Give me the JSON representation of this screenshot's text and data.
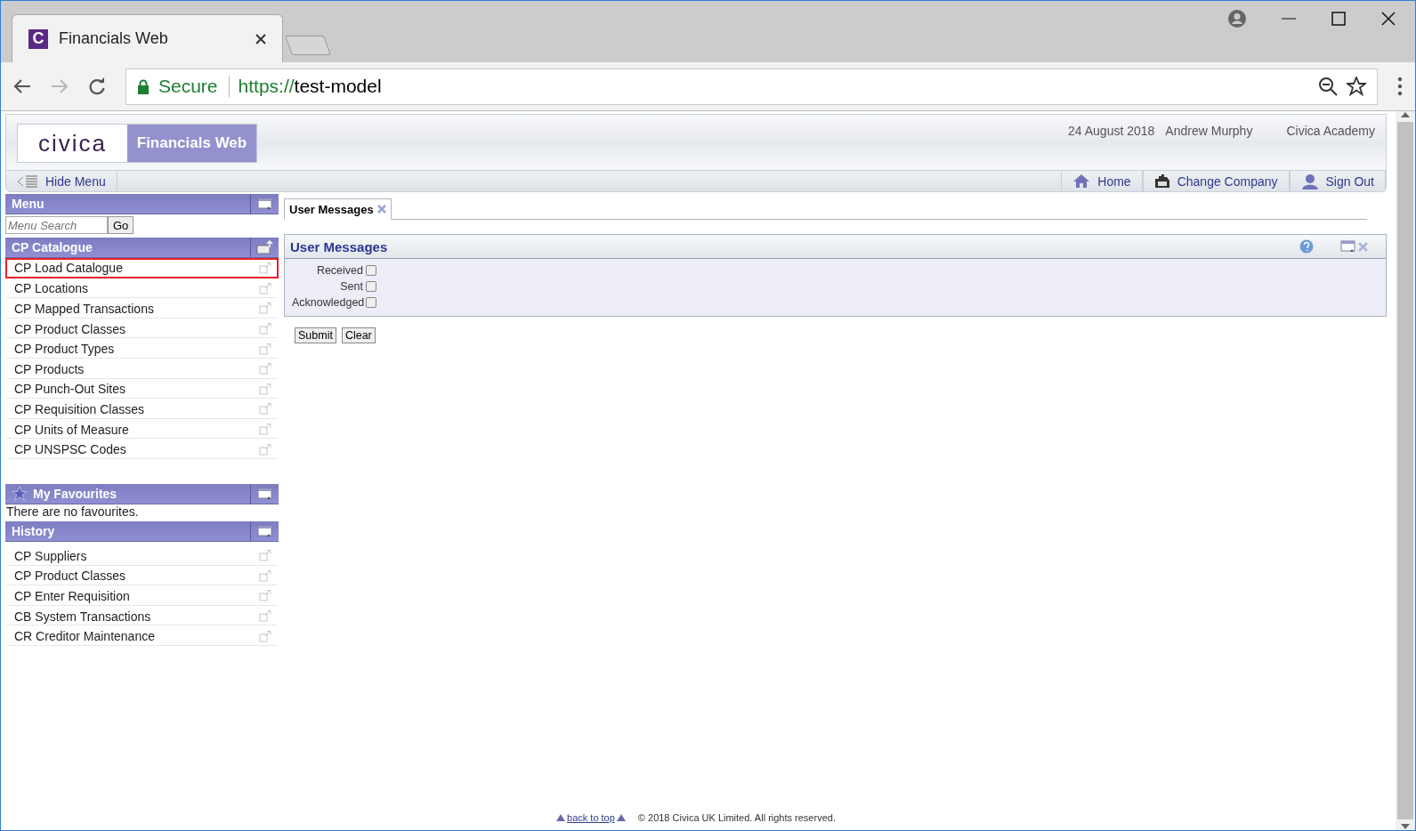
{
  "browser": {
    "tab_title": "Financials Web",
    "favicon_letter": "C",
    "security": "Secure",
    "url_scheme": "https://",
    "url_host": "test-model"
  },
  "header": {
    "logo": "civica",
    "product": "Financials Web",
    "date": "24 August 2018",
    "user": "Andrew Murphy",
    "company": "Civica Academy"
  },
  "nav": {
    "hide_menu": "Hide Menu",
    "links": [
      {
        "label": "Home",
        "kind": "home"
      },
      {
        "label": "Change Company",
        "kind": "company"
      },
      {
        "label": "Sign Out",
        "kind": "signout"
      }
    ]
  },
  "sidebar": {
    "menu": {
      "title": "Menu",
      "search_placeholder": "Menu Search",
      "go": "Go"
    },
    "section": {
      "title": "CP Catalogue",
      "items": [
        {
          "label": "CP Load Catalogue",
          "highlighted": true
        },
        {
          "label": "CP Locations",
          "highlighted": false
        },
        {
          "label": "CP Mapped Transactions",
          "highlighted": false
        },
        {
          "label": "CP Product Classes",
          "highlighted": false
        },
        {
          "label": "CP Product Types",
          "highlighted": false
        },
        {
          "label": "CP Products",
          "highlighted": false
        },
        {
          "label": "CP Punch-Out Sites",
          "highlighted": false
        },
        {
          "label": "CP Requisition Classes",
          "highlighted": false
        },
        {
          "label": "CP Units of Measure",
          "highlighted": false
        },
        {
          "label": "CP UNSPSC Codes",
          "highlighted": false
        }
      ]
    },
    "favourites": {
      "title": "My Favourites",
      "empty": "There are no favourites."
    },
    "history": {
      "title": "History",
      "items": [
        {
          "label": "CP Suppliers"
        },
        {
          "label": "CP Product Classes"
        },
        {
          "label": "CP Enter Requisition"
        },
        {
          "label": "CB System Transactions"
        },
        {
          "label": "CR Creditor Maintenance"
        }
      ]
    }
  },
  "tabs": [
    {
      "label": "User Messages",
      "selected": true
    }
  ],
  "panel": {
    "title": "User Messages",
    "filters": [
      {
        "label": "Received",
        "checked": false
      },
      {
        "label": "Sent",
        "checked": false
      },
      {
        "label": "Acknowledged",
        "checked": false
      }
    ],
    "buttons": [
      "Submit",
      "Clear"
    ]
  },
  "footer": {
    "back_to_top": "back to top",
    "copyright": "© 2018 Civica UK Limited. All rights reserved."
  }
}
